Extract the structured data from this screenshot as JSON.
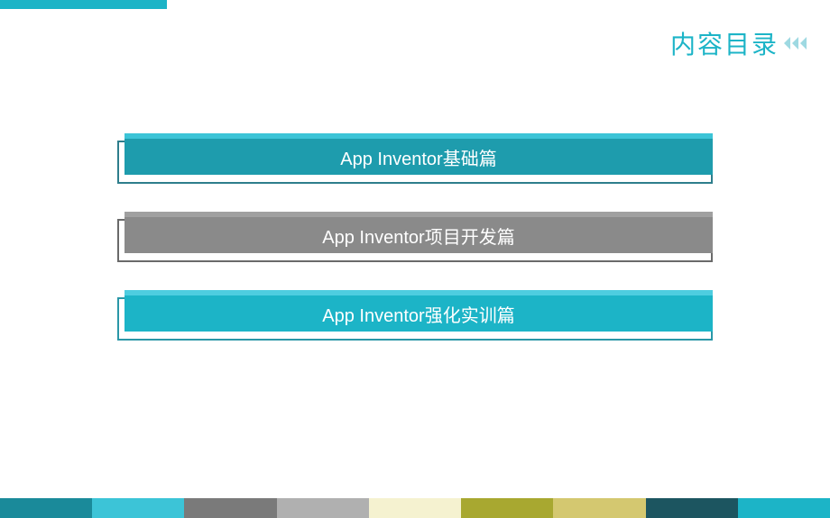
{
  "header": {
    "title": "内容目录"
  },
  "items": [
    {
      "label": "App Inventor基础篇"
    },
    {
      "label": "App Inventor项目开发篇"
    },
    {
      "label": "App Inventor强化实训篇"
    }
  ]
}
